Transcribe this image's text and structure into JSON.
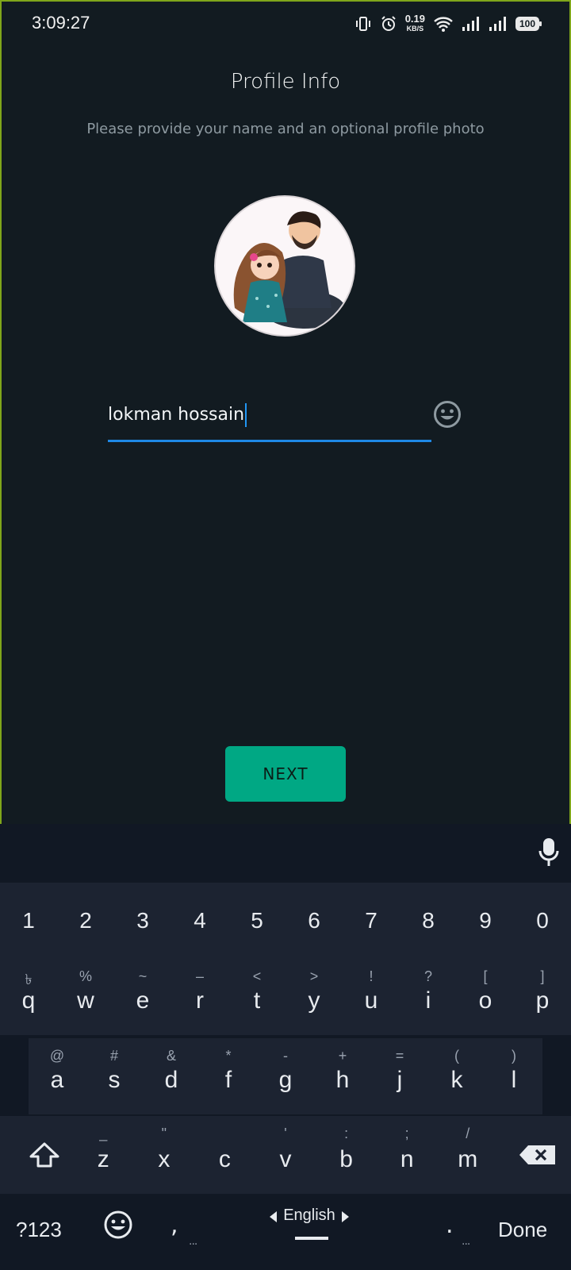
{
  "status": {
    "time": "3:09:27",
    "speed_value": "0.19",
    "speed_unit": "KB/S",
    "battery": "100",
    "icons": [
      "vibrate-icon",
      "alarm-icon",
      "wifi-icon",
      "signal-icon",
      "signal-icon",
      "battery-icon"
    ]
  },
  "page": {
    "title": "Profile Info",
    "subtitle": "Please provide your name and an optional profile photo"
  },
  "name_field": {
    "value": "lokman hossain"
  },
  "next_label": "NEXT",
  "keyboard": {
    "numbers": [
      "1",
      "2",
      "3",
      "4",
      "5",
      "6",
      "7",
      "8",
      "9",
      "0"
    ],
    "row_q": [
      {
        "main": "q",
        "alt": "৳"
      },
      {
        "main": "w",
        "alt": "%"
      },
      {
        "main": "e",
        "alt": "~"
      },
      {
        "main": "r",
        "alt": "–"
      },
      {
        "main": "t",
        "alt": "<"
      },
      {
        "main": "y",
        "alt": ">"
      },
      {
        "main": "u",
        "alt": "!"
      },
      {
        "main": "i",
        "alt": "?"
      },
      {
        "main": "o",
        "alt": "["
      },
      {
        "main": "p",
        "alt": "]"
      }
    ],
    "row_a": [
      {
        "main": "a",
        "alt": "@"
      },
      {
        "main": "s",
        "alt": "#"
      },
      {
        "main": "d",
        "alt": "&"
      },
      {
        "main": "f",
        "alt": "*"
      },
      {
        "main": "g",
        "alt": "-"
      },
      {
        "main": "h",
        "alt": "+"
      },
      {
        "main": "j",
        "alt": "="
      },
      {
        "main": "k",
        "alt": "("
      },
      {
        "main": "l",
        "alt": ")"
      }
    ],
    "row_z": [
      {
        "main": "z",
        "alt": "_"
      },
      {
        "main": "x",
        "alt": "\""
      },
      {
        "main": "c",
        "alt": ""
      },
      {
        "main": "v",
        "alt": "'"
      },
      {
        "main": "b",
        "alt": ":"
      },
      {
        "main": "n",
        "alt": ";"
      },
      {
        "main": "m",
        "alt": "/"
      }
    ],
    "sym_label": "?123",
    "comma": ",",
    "language": "English",
    "period": ".",
    "done_label": "Done",
    "dots": "..."
  }
}
